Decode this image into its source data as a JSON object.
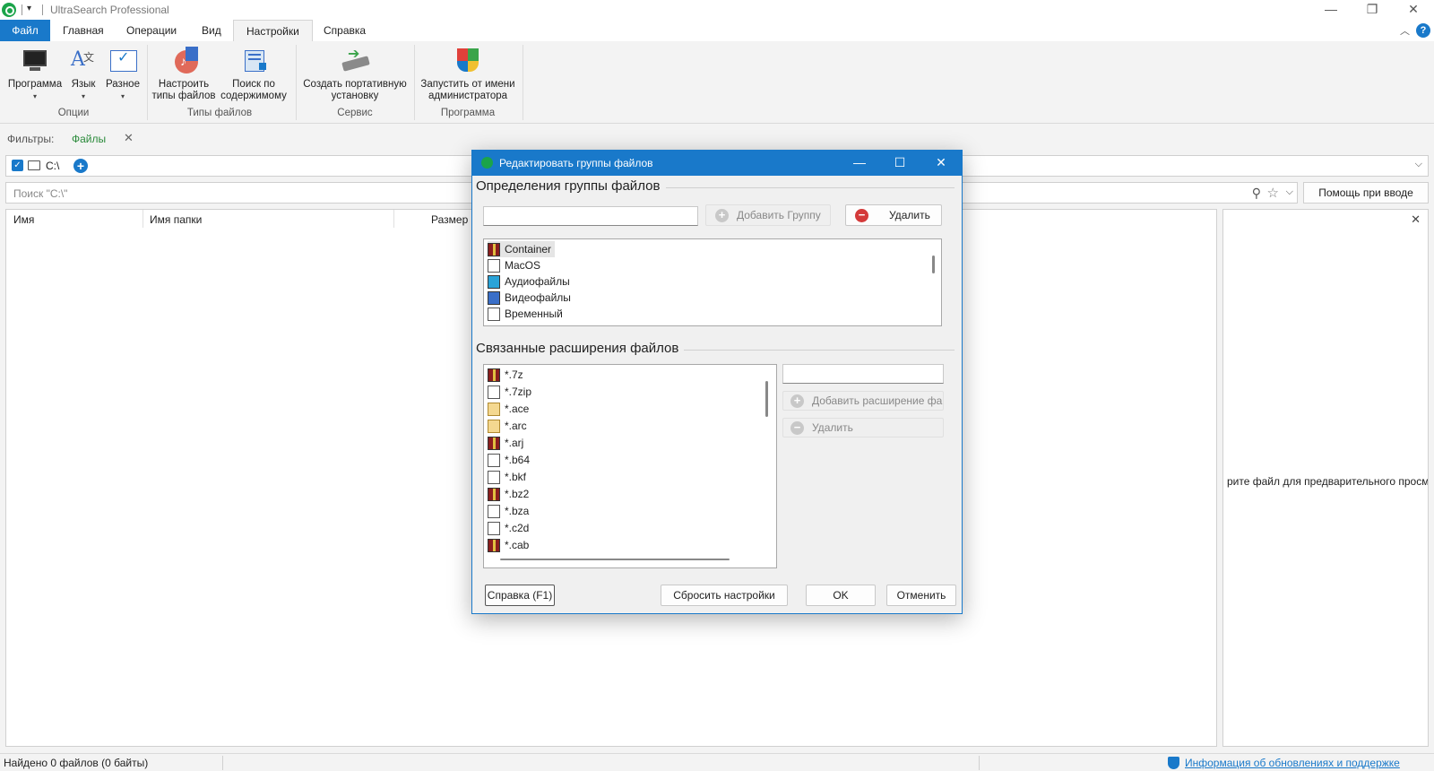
{
  "app": {
    "title": "UltraSearch Professional"
  },
  "window_controls": {
    "minimize": "—",
    "restore": "❐",
    "close": "✕"
  },
  "tabs": [
    {
      "label": "Файл"
    },
    {
      "label": "Главная"
    },
    {
      "label": "Операции"
    },
    {
      "label": "Вид"
    },
    {
      "label": "Настройки"
    },
    {
      "label": "Справка"
    }
  ],
  "ribbon": {
    "groups": [
      {
        "label": "Опции"
      },
      {
        "label": "Типы файлов"
      },
      {
        "label": "Сервис"
      },
      {
        "label": "Программа"
      }
    ],
    "buttons": [
      {
        "label": "Программа"
      },
      {
        "label": "Язык"
      },
      {
        "label": "Разное"
      },
      {
        "label_line1": "Настроить",
        "label_line2": "типы файлов"
      },
      {
        "label_line1": "Поиск по",
        "label_line2": "содержимому"
      },
      {
        "label_line1": "Создать портативную",
        "label_line2": "установку"
      },
      {
        "label_line1": "Запустить от имени",
        "label_line2": "администратора"
      }
    ]
  },
  "filters": {
    "label": "Фильтры:",
    "files": "Файлы"
  },
  "path": {
    "value": "C:\\"
  },
  "search": {
    "placeholder": "Поиск \"C:\\\"",
    "help_button": "Помощь при вводе"
  },
  "results": {
    "columns": [
      "Имя",
      "Имя папки",
      "Размер"
    ]
  },
  "preview": {
    "text": "рите файл для предварительного просм"
  },
  "status": {
    "found": "Найдено 0 файлов (0 байты)",
    "link": "Информация об обновлениях и поддержке"
  },
  "dialog": {
    "title": "Редактировать группы файлов",
    "section1": "Определения группы файлов",
    "add_group": "Добавить Группу",
    "delete": "Удалить",
    "groups": [
      {
        "name": "Container",
        "icon": "archive-icon"
      },
      {
        "name": "MacOS",
        "icon": "document-icon"
      },
      {
        "name": "Аудиофайлы",
        "icon": "audio-icon"
      },
      {
        "name": "Видеофайлы",
        "icon": "video-icon"
      },
      {
        "name": "Временный",
        "icon": "document-icon"
      }
    ],
    "section2": "Связанные расширения файлов",
    "extensions": [
      {
        "ext": "*.7z",
        "icon": "archive-icon"
      },
      {
        "ext": "*.7zip",
        "icon": "document-icon"
      },
      {
        "ext": "*.ace",
        "icon": "ace-icon"
      },
      {
        "ext": "*.arc",
        "icon": "ace-icon"
      },
      {
        "ext": "*.arj",
        "icon": "archive-icon"
      },
      {
        "ext": "*.b64",
        "icon": "document-icon"
      },
      {
        "ext": "*.bkf",
        "icon": "document-icon"
      },
      {
        "ext": "*.bz2",
        "icon": "archive-icon"
      },
      {
        "ext": "*.bza",
        "icon": "document-icon"
      },
      {
        "ext": "*.c2d",
        "icon": "document-icon"
      },
      {
        "ext": "*.cab",
        "icon": "archive-icon"
      }
    ],
    "add_extension": "Добавить расширение фай",
    "delete_ext": "Удалить",
    "help": "Справка (F1)",
    "reset": "Сбросить настройки",
    "ok": "OK",
    "cancel": "Отменить"
  },
  "colors": {
    "accent": "#1979ca",
    "brand": "#1ba44a",
    "link": "#1979ca"
  }
}
